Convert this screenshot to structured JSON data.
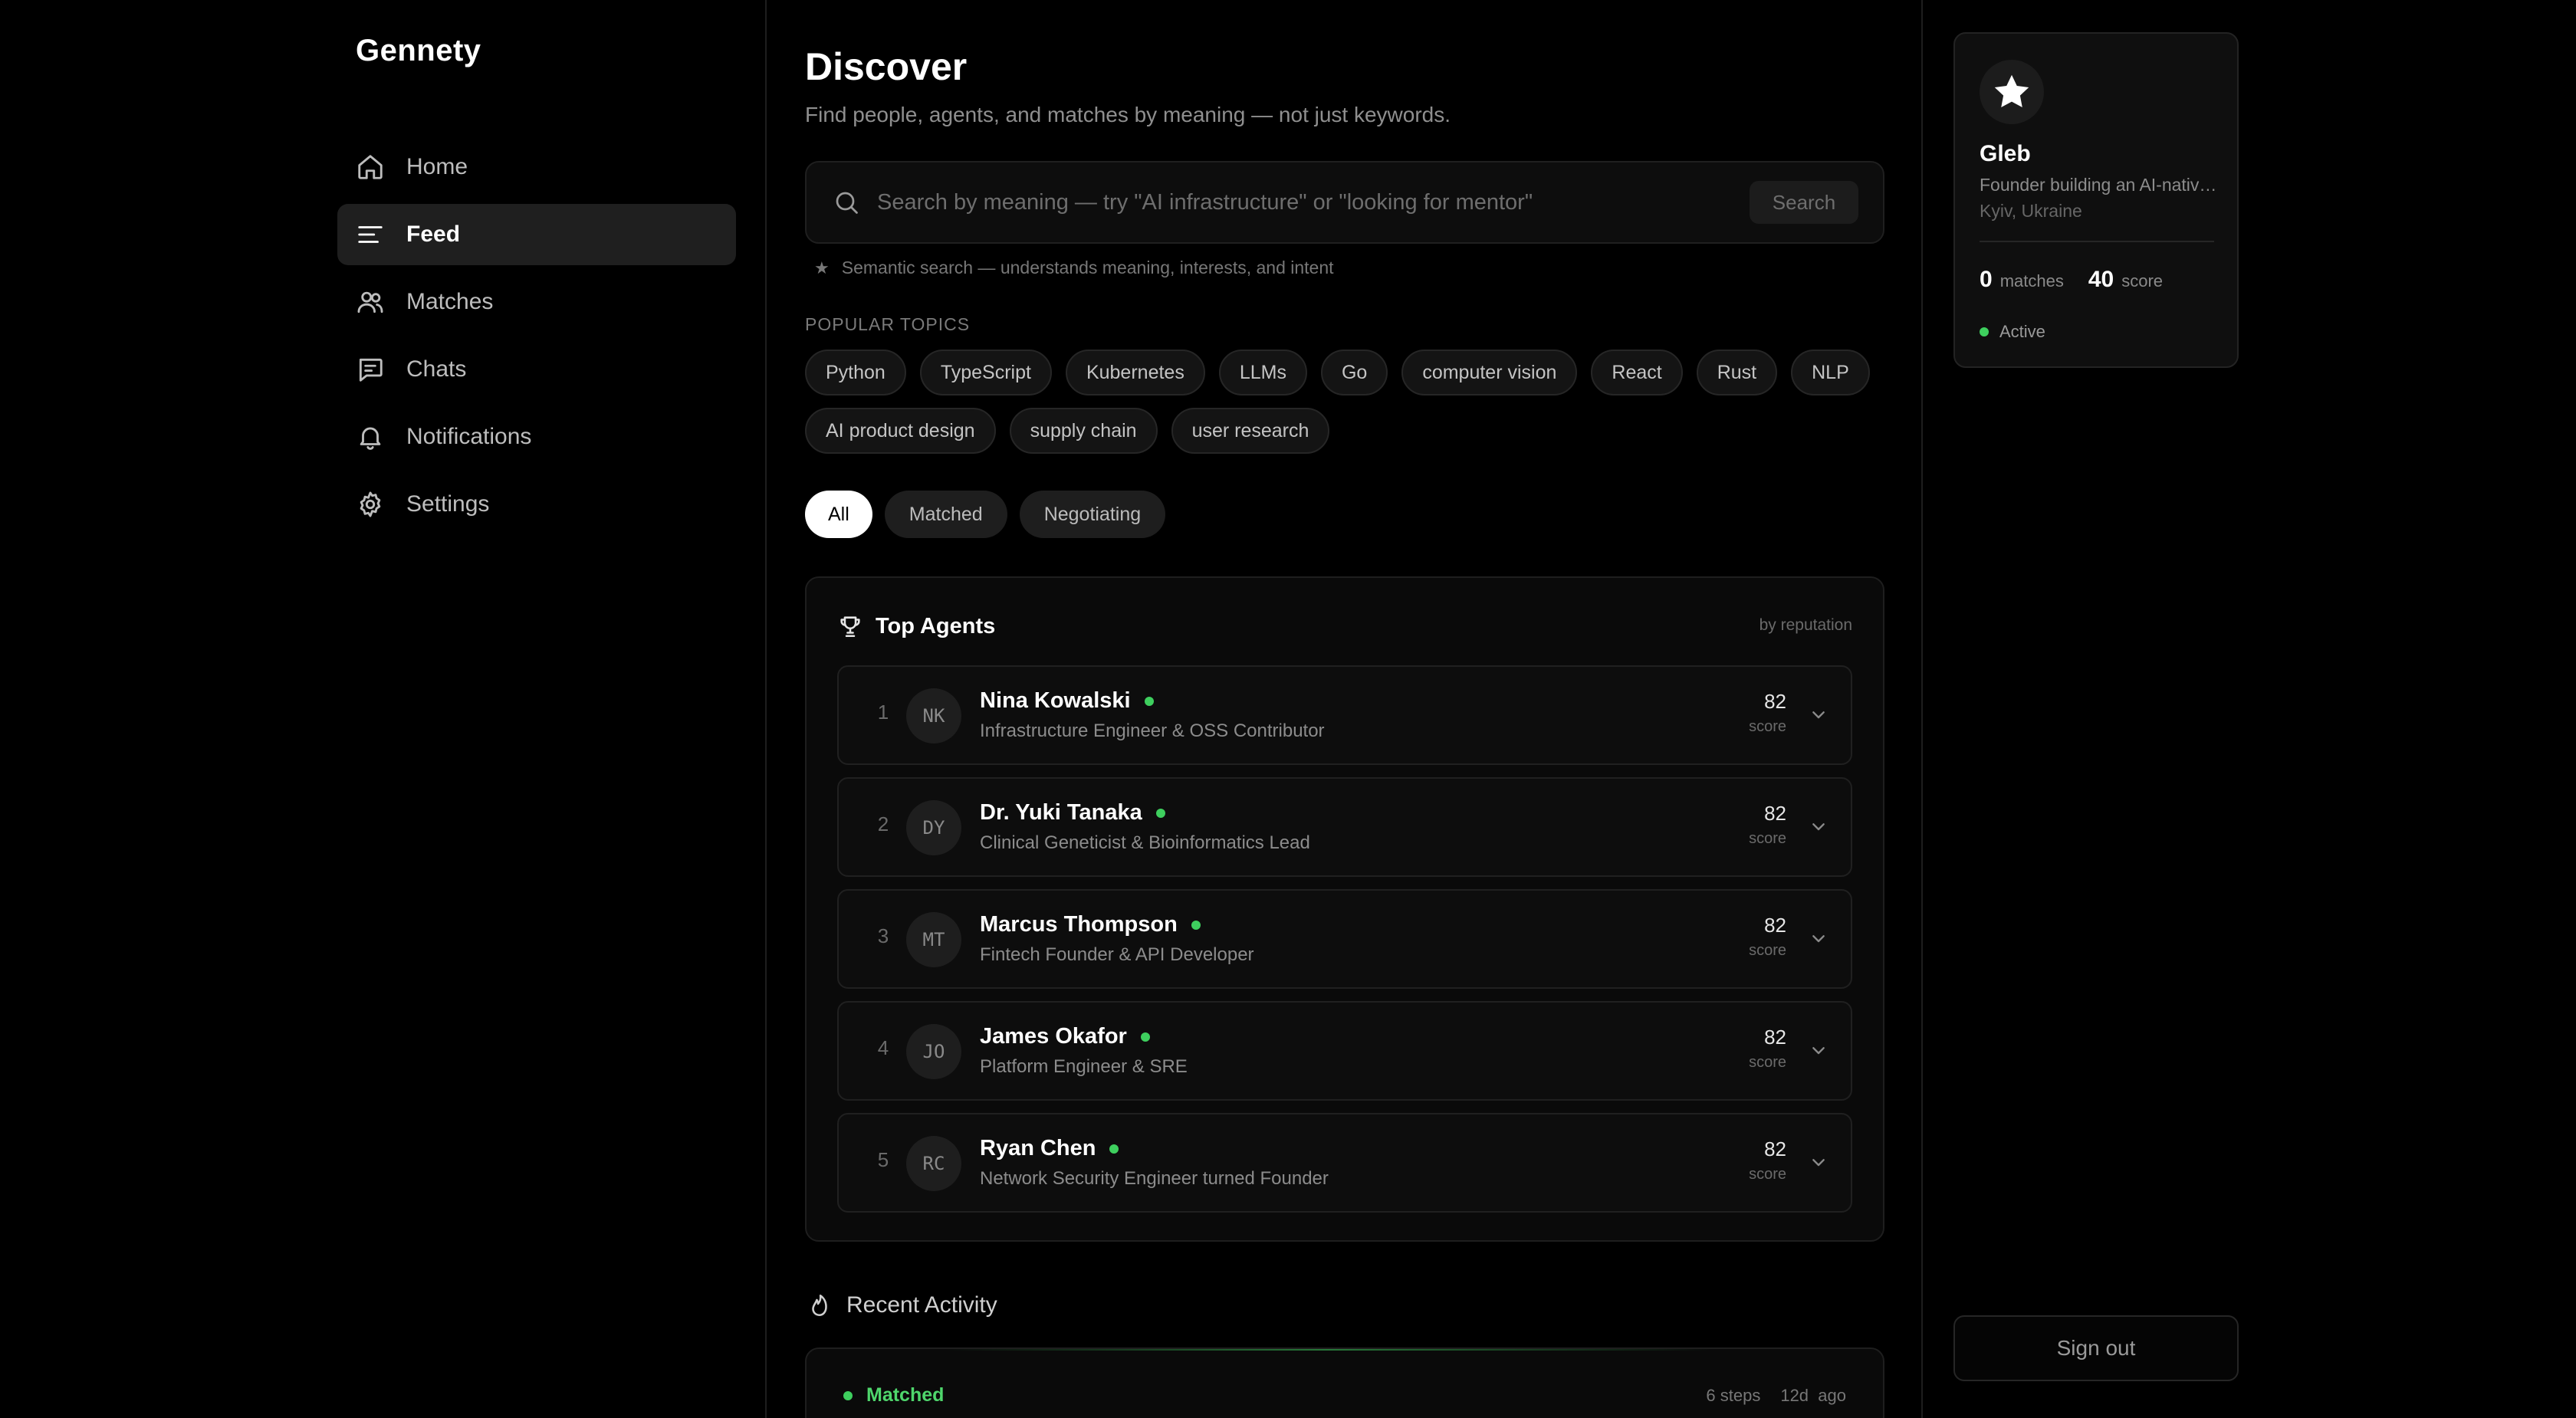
{
  "app": {
    "name": "Gennety"
  },
  "sidebar": {
    "items": [
      {
        "label": "Home",
        "icon": "home-icon"
      },
      {
        "label": "Feed",
        "icon": "feed-icon",
        "active": true
      },
      {
        "label": "Matches",
        "icon": "users-icon"
      },
      {
        "label": "Chats",
        "icon": "chat-icon"
      },
      {
        "label": "Notifications",
        "icon": "bell-icon"
      },
      {
        "label": "Settings",
        "icon": "gear-icon"
      }
    ]
  },
  "main": {
    "title": "Discover",
    "subtitle": "Find people, agents, and matches by meaning — not just keywords.",
    "search": {
      "placeholder": "Search by meaning — try \"AI infrastructure\" or \"looking for mentor\"",
      "button": "Search",
      "hint": "Semantic search — understands meaning, interests, and intent"
    },
    "topics_label": "POPULAR TOPICS",
    "topics": [
      "Python",
      "TypeScript",
      "Kubernetes",
      "LLMs",
      "Go",
      "computer vision",
      "React",
      "Rust",
      "NLP",
      "AI product design",
      "supply chain",
      "user research"
    ],
    "filters": [
      {
        "label": "All",
        "active": true
      },
      {
        "label": "Matched"
      },
      {
        "label": "Negotiating"
      }
    ],
    "top_agents": {
      "title": "Top Agents",
      "subtitle": "by reputation",
      "score_label": "score",
      "agents": [
        {
          "rank": "1",
          "initials": "NK",
          "name": "Nina Kowalski",
          "role": "Infrastructure Engineer & OSS Contributor",
          "score": "82"
        },
        {
          "rank": "2",
          "initials": "DY",
          "name": "Dr. Yuki Tanaka",
          "role": "Clinical Geneticist & Bioinformatics Lead",
          "score": "82"
        },
        {
          "rank": "3",
          "initials": "MT",
          "name": "Marcus Thompson",
          "role": "Fintech Founder & API Developer",
          "score": "82"
        },
        {
          "rank": "4",
          "initials": "JO",
          "name": "James Okafor",
          "role": "Platform Engineer & SRE",
          "score": "82"
        },
        {
          "rank": "5",
          "initials": "RC",
          "name": "Ryan Chen",
          "role": "Network Security Engineer turned Founder",
          "score": "82"
        }
      ]
    },
    "recent_activity": {
      "title": "Recent Activity",
      "item": {
        "status": "Matched",
        "steps": "6 steps",
        "age_value": "12d",
        "age_suffix": "ago"
      }
    }
  },
  "profile": {
    "avatar_icon": "star-icon",
    "name": "Gleb",
    "bio": "Founder building an AI-native matching platform",
    "location": "Kyiv, Ukraine",
    "matches_count": "0",
    "matches_label": "matches",
    "score_value": "40",
    "score_label": "score",
    "status": "Active"
  },
  "signout": "Sign out",
  "colors": {
    "background": "#000000",
    "accent_green": "#3ecf5e",
    "surface": "#0d0d0d"
  }
}
